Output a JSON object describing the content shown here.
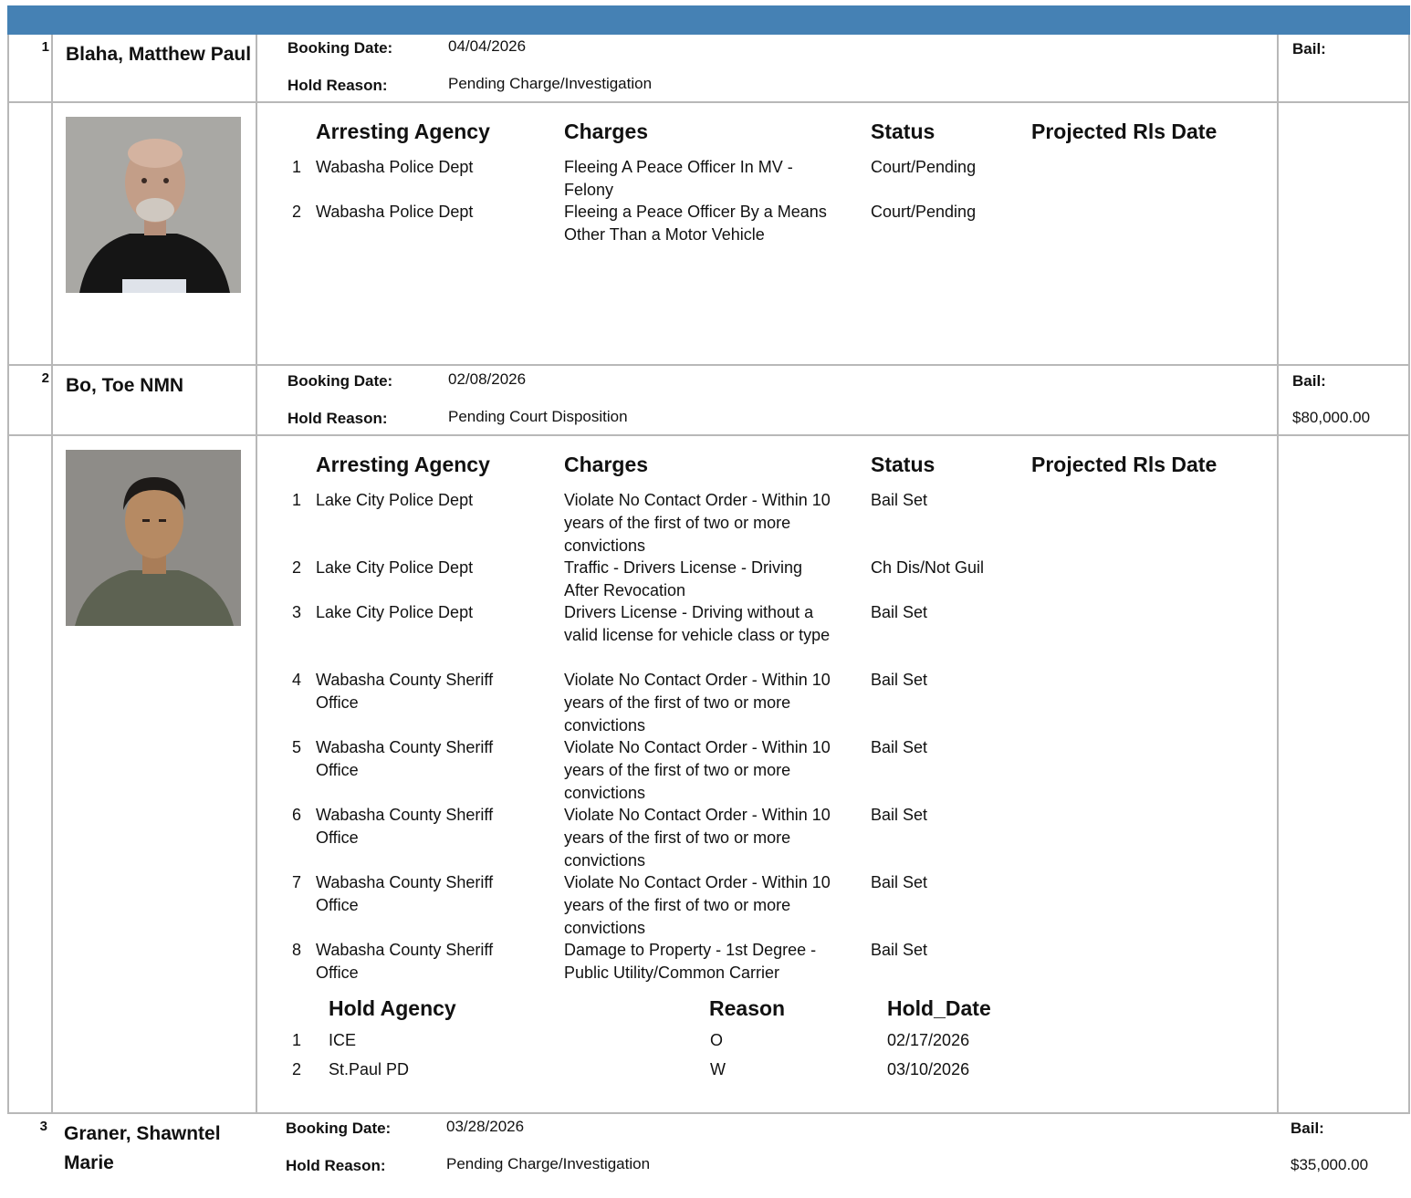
{
  "labels": {
    "booking_date": "Booking Date:",
    "hold_reason": "Hold Reason:",
    "bail": "Bail:",
    "col_agency": "Arresting Agency",
    "col_charges": "Charges",
    "col_status": "Status",
    "col_release": "Projected Rls Date",
    "col_hold_agency": "Hold Agency",
    "col_reason": "Reason",
    "col_hold_date": "Hold_Date"
  },
  "inmates": [
    {
      "num": "1",
      "name": "Blaha, Matthew Paul",
      "booking_date": "04/04/2026",
      "hold_reason": "Pending Charge/Investigation",
      "bail": "",
      "charges": [
        {
          "idx": "1",
          "agency": "Wabasha Police Dept",
          "charge": "Fleeing A Peace Officer In MV - Felony",
          "status": "Court/Pending"
        },
        {
          "idx": "2",
          "agency": "Wabasha Police Dept",
          "charge": "Fleeing a Peace Officer By a Means Other Than a Motor Vehicle",
          "status": "Court/Pending"
        }
      ]
    },
    {
      "num": "2",
      "name": "Bo, Toe NMN",
      "booking_date": "02/08/2026",
      "hold_reason": "Pending Court Disposition",
      "bail": "$80,000.00",
      "charges": [
        {
          "idx": "1",
          "agency": "Lake City Police Dept",
          "charge": "Violate No Contact Order - Within 10 years of the first of two or more convictions",
          "status": "Bail Set"
        },
        {
          "idx": "2",
          "agency": "Lake City Police Dept",
          "charge": "Traffic - Drivers License - Driving After Revocation",
          "status": "Ch Dis/Not Guil"
        },
        {
          "idx": "3",
          "agency": "Lake City Police Dept",
          "charge": "Drivers License - Driving without a valid license for vehicle class or type",
          "status": "Bail Set"
        },
        {
          "idx": "4",
          "agency": "Wabasha County Sheriff Office",
          "charge": "Violate No Contact Order - Within 10 years of the first of two or more convictions",
          "status": "Bail Set"
        },
        {
          "idx": "5",
          "agency": "Wabasha County Sheriff Office",
          "charge": "Violate No Contact Order - Within 10 years of the first of two or more convictions",
          "status": "Bail Set"
        },
        {
          "idx": "6",
          "agency": "Wabasha County Sheriff Office",
          "charge": "Violate No Contact Order - Within 10 years of the first of two or more convictions",
          "status": "Bail Set"
        },
        {
          "idx": "7",
          "agency": "Wabasha County Sheriff Office",
          "charge": "Violate No Contact Order - Within 10 years of the first of two or more convictions",
          "status": "Bail Set"
        },
        {
          "idx": "8",
          "agency": "Wabasha County Sheriff Office",
          "charge": "Damage to Property - 1st Degree - Public Utility/Common Carrier",
          "status": "Bail Set"
        }
      ],
      "holds": [
        {
          "idx": "1",
          "agency": "ICE",
          "reason": "O",
          "date": "02/17/2026"
        },
        {
          "idx": "2",
          "agency": "St.Paul PD",
          "reason": "W",
          "date": "03/10/2026"
        }
      ]
    },
    {
      "num": "3",
      "name": "Graner, Shawntel Marie",
      "booking_date": "03/28/2026",
      "hold_reason": "Pending Charge/Investigation",
      "bail": "$35,000.00"
    }
  ]
}
